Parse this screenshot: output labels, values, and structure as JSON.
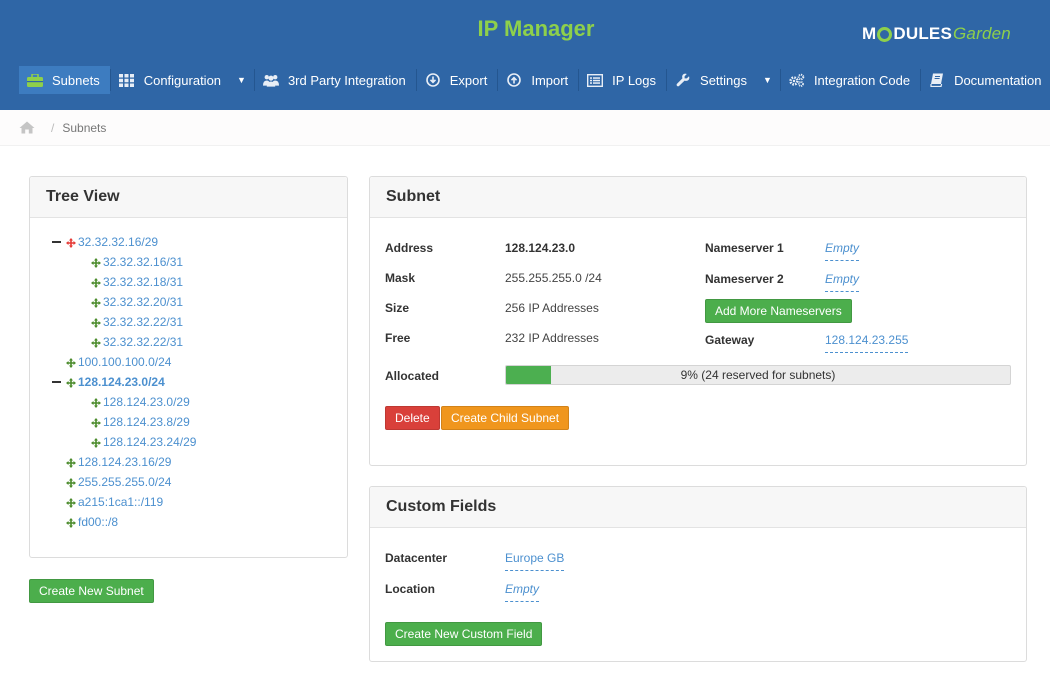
{
  "header": {
    "title": "IP Manager",
    "logo": {
      "part1": "M",
      "part2": "DULES",
      "part3": "Garden"
    }
  },
  "nav": {
    "items": [
      {
        "label": "Subnets",
        "icon": "briefcase-icon",
        "active": true
      },
      {
        "label": "Configuration",
        "icon": "grid-icon",
        "dropdown": true
      },
      {
        "label": "3rd Party Integration",
        "icon": "users-icon"
      },
      {
        "label": "Export",
        "icon": "download-icon"
      },
      {
        "label": "Import",
        "icon": "upload-icon"
      },
      {
        "label": "IP Logs",
        "icon": "list-icon"
      },
      {
        "label": "Settings",
        "icon": "wrench-icon",
        "dropdown": true
      },
      {
        "label": "Integration Code",
        "icon": "cogs-icon"
      },
      {
        "label": "Documentation",
        "icon": "book-icon"
      }
    ]
  },
  "breadcrumb": {
    "current": "Subnets"
  },
  "tree_view": {
    "title": "Tree View",
    "nodes": [
      {
        "label": "32.32.32.16/29",
        "level": 0,
        "expanded": true,
        "marker": "red"
      },
      {
        "label": "32.32.32.16/31",
        "level": 1
      },
      {
        "label": "32.32.32.18/31",
        "level": 1
      },
      {
        "label": "32.32.32.20/31",
        "level": 1
      },
      {
        "label": "32.32.32.22/31",
        "level": 1
      },
      {
        "label": "32.32.32.22/31",
        "level": 1
      },
      {
        "label": "100.100.100.0/24",
        "level": 0
      },
      {
        "label": "128.124.23.0/24",
        "level": 0,
        "expanded": true,
        "selected": true
      },
      {
        "label": "128.124.23.0/29",
        "level": 1
      },
      {
        "label": "128.124.23.8/29",
        "level": 1
      },
      {
        "label": "128.124.23.24/29",
        "level": 1
      },
      {
        "label": "128.124.23.16/29",
        "level": 0
      },
      {
        "label": "255.255.255.0/24",
        "level": 0
      },
      {
        "label": "a215:1ca1::/119",
        "level": 0
      },
      {
        "label": "fd00::/8",
        "level": 0
      }
    ],
    "create_button": "Create New Subnet"
  },
  "subnet": {
    "title": "Subnet",
    "address_label": "Address",
    "address": "128.124.23.0",
    "mask_label": "Mask",
    "mask": "255.255.255.0 /24",
    "size_label": "Size",
    "size": "256 IP Addresses",
    "free_label": "Free",
    "free": "232 IP Addresses",
    "allocated_label": "Allocated",
    "allocated_percent": 9,
    "allocated_text": "9% (24 reserved for subnets)",
    "ns1_label": "Nameserver 1",
    "ns1": "Empty",
    "ns2_label": "Nameserver 2",
    "ns2": "Empty",
    "add_ns_button": "Add More Nameservers",
    "gateway_label": "Gateway",
    "gateway": "128.124.23.255",
    "delete_button": "Delete",
    "create_child_button": "Create Child Subnet"
  },
  "custom_fields": {
    "title": "Custom Fields",
    "datacenter_label": "Datacenter",
    "datacenter": "Europe GB",
    "location_label": "Location",
    "location": "Empty",
    "create_button": "Create New Custom Field"
  },
  "colors": {
    "header_bg": "#2f66a6",
    "title_green": "#8ed04b",
    "link_blue": "#4c90cf",
    "progress_green": "#4caf50",
    "button_green": "#4cae4c",
    "button_red": "#d9403a",
    "button_orange": "#f0961d",
    "tree_marker_red": "#e53935",
    "tree_marker_green": "#4a8a2a"
  }
}
